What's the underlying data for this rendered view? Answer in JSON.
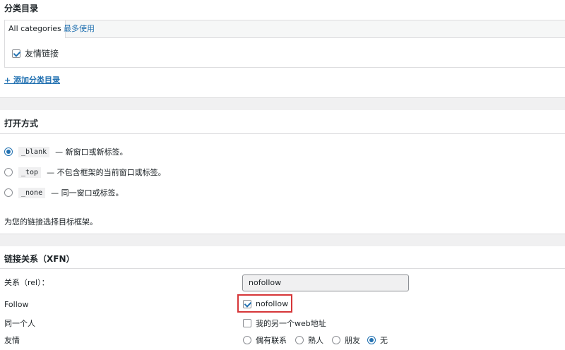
{
  "categories": {
    "title": "分类目录",
    "tabs": [
      {
        "label": "All categories"
      },
      {
        "label": "最多使用"
      }
    ],
    "items": [
      {
        "label": "友情链接",
        "checked": true
      }
    ],
    "add_link": "+ 添加分类目录"
  },
  "target": {
    "title": "打开方式",
    "options": [
      {
        "code": "_blank",
        "desc": "— 新窗口或新标签。",
        "checked": true
      },
      {
        "code": "_top",
        "desc": "— 不包含框架的当前窗口或标签。",
        "checked": false
      },
      {
        "code": "_none",
        "desc": "— 同一窗口或标签。",
        "checked": false
      }
    ],
    "hint": "为您的链接选择目标框架。"
  },
  "xfn": {
    "title": "链接关系（XFN）",
    "rel_label": "关系（rel）：",
    "rel_value": "nofollow",
    "follow_label": "Follow",
    "follow_option": "nofollow",
    "same_person_label": "同一个人",
    "same_person_option": "我的另一个web地址",
    "friendship_label": "友情",
    "friendship_options": [
      {
        "label": "偶有联系",
        "checked": false
      },
      {
        "label": "熟人",
        "checked": false
      },
      {
        "label": "朋友",
        "checked": false
      },
      {
        "label": "无",
        "checked": true
      }
    ]
  },
  "colors": {
    "accent": "#2271b1",
    "highlight": "#d63638"
  }
}
